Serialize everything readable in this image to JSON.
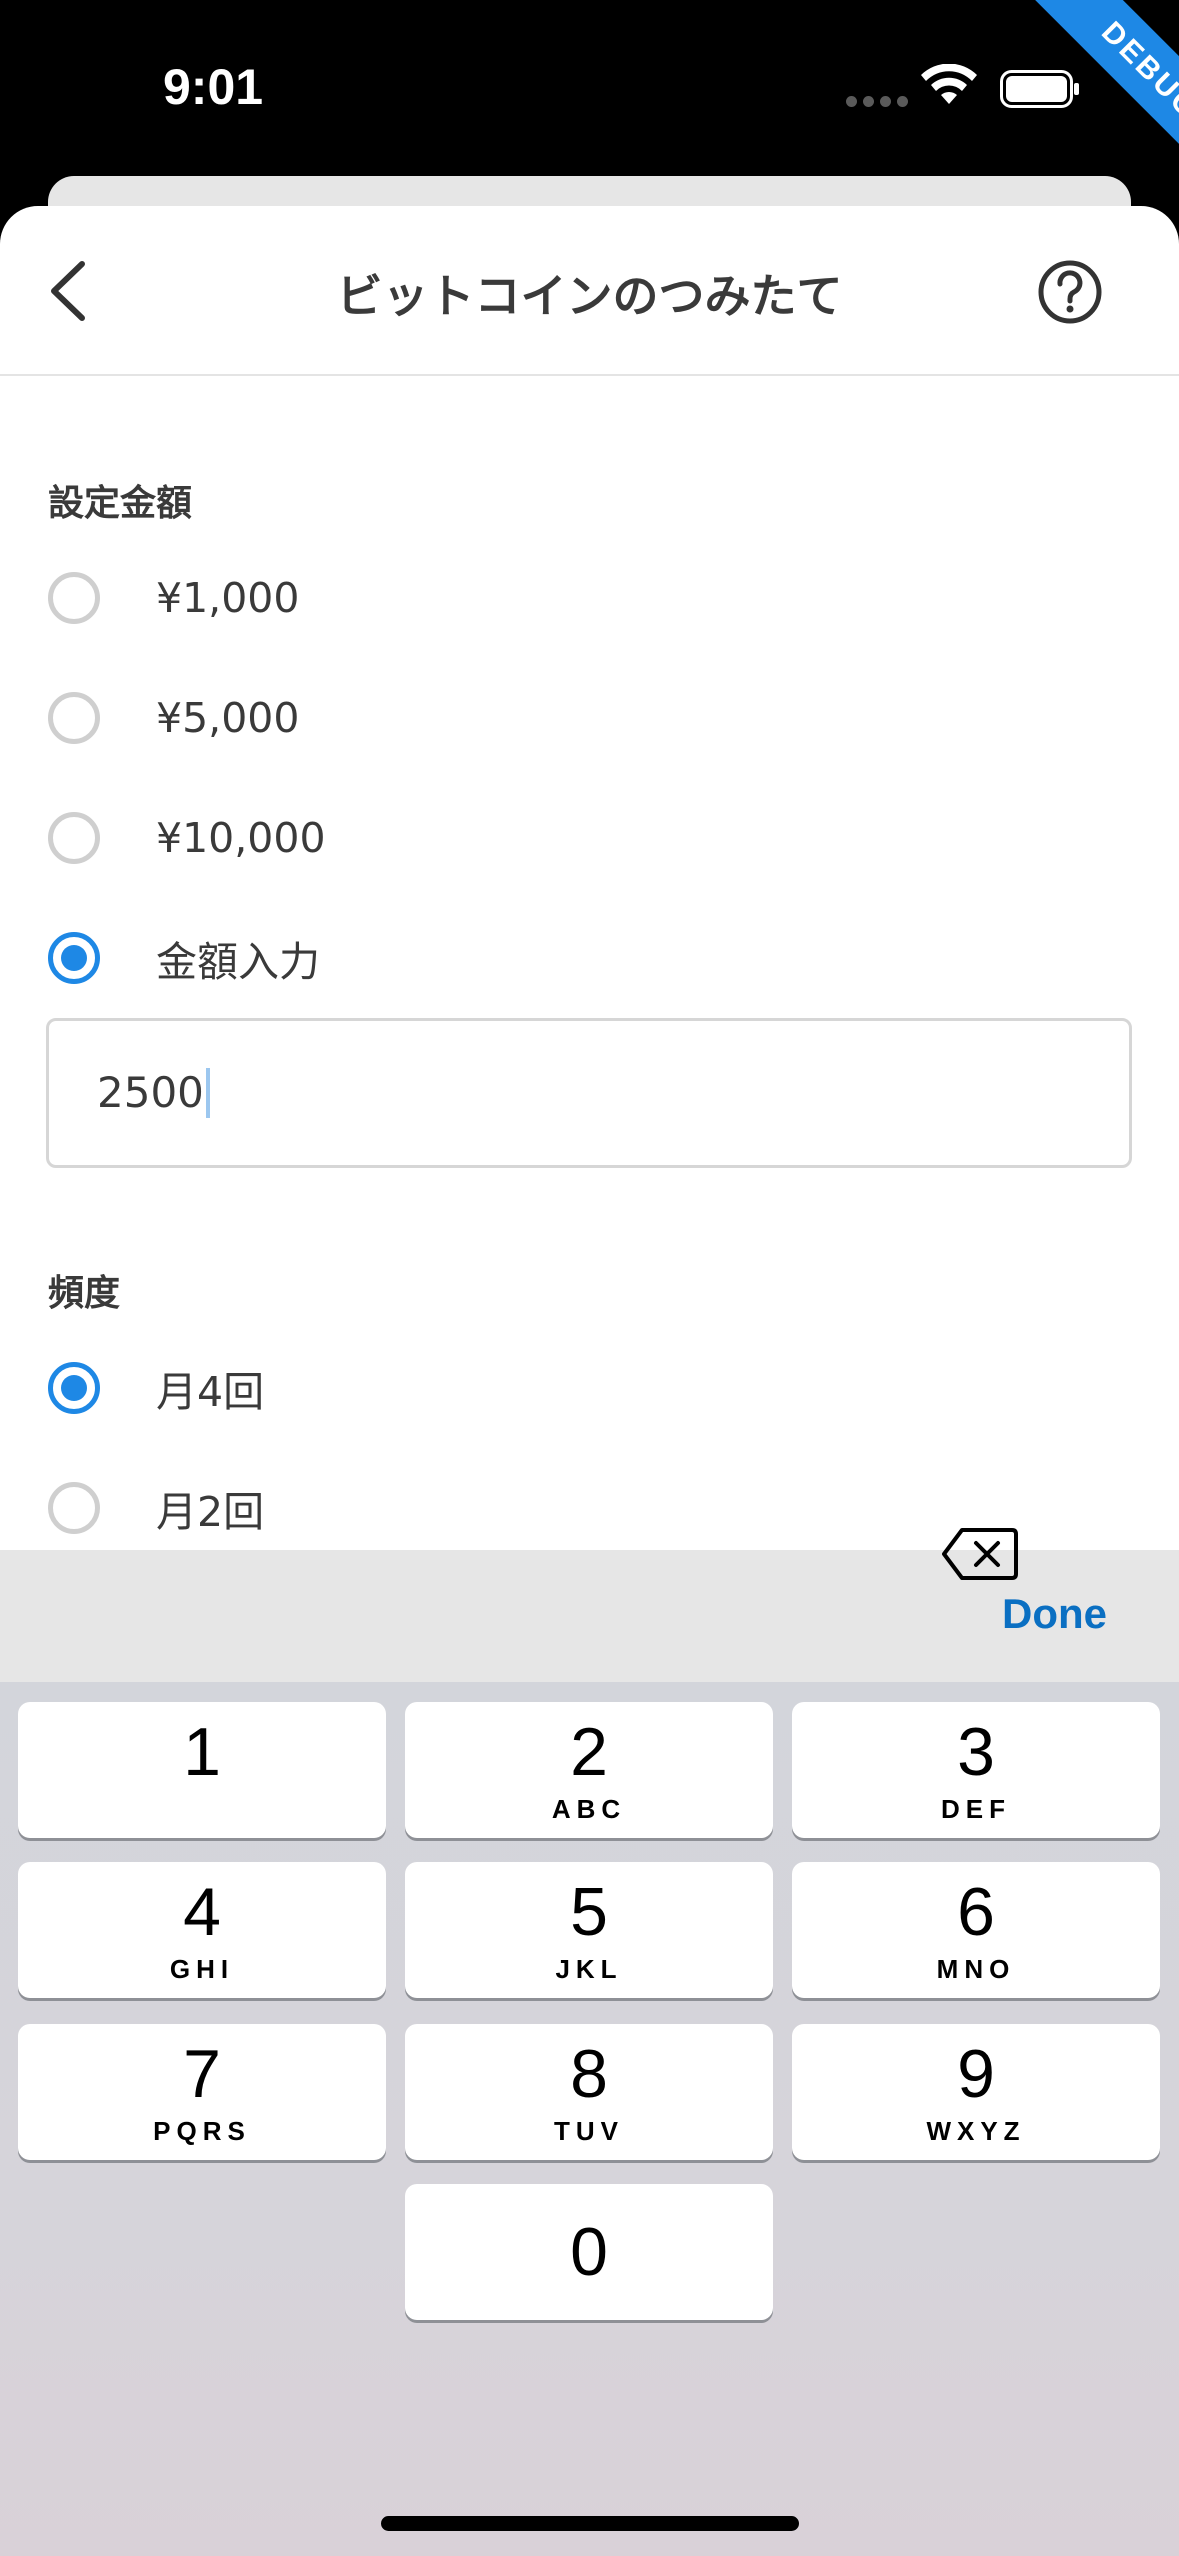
{
  "status_bar": {
    "time": "9:01",
    "icons": [
      "signal-dots-icon",
      "wifi-icon",
      "battery-icon"
    ],
    "debug_banner": "DEBUG"
  },
  "header": {
    "title": "ビットコインのつみたて",
    "back_icon": "chevron-left-icon",
    "help_icon": "question-circle-icon"
  },
  "amount_section": {
    "label": "設定金額",
    "options": [
      {
        "label": "¥1,000",
        "selected": false
      },
      {
        "label": "¥5,000",
        "selected": false
      },
      {
        "label": "¥10,000",
        "selected": false
      },
      {
        "label": "金額入力",
        "selected": true
      }
    ],
    "input_value": "2500"
  },
  "frequency_section": {
    "label": "頻度",
    "options": [
      {
        "label": "月4回",
        "selected": true
      },
      {
        "label": "月2回",
        "selected": false
      }
    ]
  },
  "keyboard": {
    "done_label": "Done",
    "keys": [
      {
        "digit": "1",
        "letters": ""
      },
      {
        "digit": "2",
        "letters": "ABC"
      },
      {
        "digit": "3",
        "letters": "DEF"
      },
      {
        "digit": "4",
        "letters": "GHI"
      },
      {
        "digit": "5",
        "letters": "JKL"
      },
      {
        "digit": "6",
        "letters": "MNO"
      },
      {
        "digit": "7",
        "letters": "PQRS"
      },
      {
        "digit": "8",
        "letters": "TUV"
      },
      {
        "digit": "9",
        "letters": "WXYZ"
      },
      {
        "digit": "0",
        "letters": ""
      }
    ],
    "backspace_icon": "backspace-icon"
  },
  "colors": {
    "accent": "#1e88e5",
    "done": "#0a6fc2",
    "text": "#3a3a3a",
    "radio_off": "#cfcfcf"
  }
}
